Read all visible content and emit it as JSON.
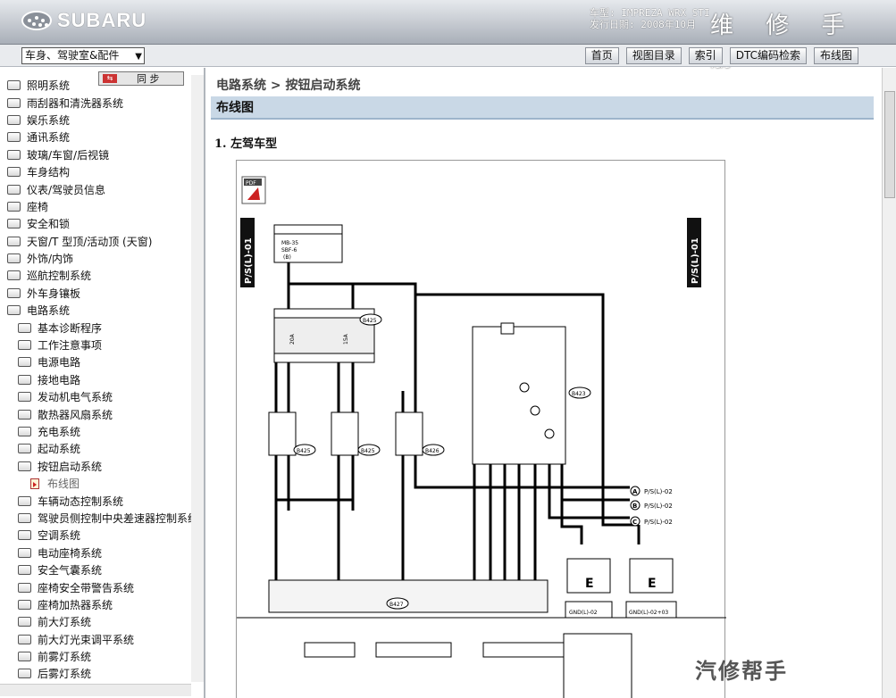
{
  "header": {
    "brand": "SUBARU",
    "model_line": "车型: IMPREZA WRX STI",
    "date_line": "发行日期: 2008年10月",
    "title": "维 修 手 册"
  },
  "toolbar": {
    "category_selected": "车身、驾驶室&配件",
    "buttons": [
      "首页",
      "视图目录",
      "索引",
      "DTC编码检索",
      "布线图"
    ]
  },
  "sidebar": {
    "sync_label": "同 步",
    "items": [
      {
        "label": "照明系统",
        "level": 0
      },
      {
        "label": "雨刮器和清洗器系统",
        "level": 0
      },
      {
        "label": "娱乐系统",
        "level": 0
      },
      {
        "label": "通讯系统",
        "level": 0
      },
      {
        "label": "玻璃/车窗/后视镜",
        "level": 0
      },
      {
        "label": "车身结构",
        "level": 0
      },
      {
        "label": "仪表/驾驶员信息",
        "level": 0
      },
      {
        "label": "座椅",
        "level": 0
      },
      {
        "label": "安全和锁",
        "level": 0
      },
      {
        "label": "天窗/T 型顶/活动顶 (天窗)",
        "level": 0
      },
      {
        "label": "外饰/内饰",
        "level": 0
      },
      {
        "label": "巡航控制系统",
        "level": 0
      },
      {
        "label": "外车身镶板",
        "level": 0
      },
      {
        "label": "电路系统",
        "level": 0
      },
      {
        "label": "基本诊断程序",
        "level": 1
      },
      {
        "label": "工作注意事项",
        "level": 1
      },
      {
        "label": "电源电路",
        "level": 1
      },
      {
        "label": "接地电路",
        "level": 1
      },
      {
        "label": "发动机电气系统",
        "level": 1
      },
      {
        "label": "散热器风扇系统",
        "level": 1
      },
      {
        "label": "充电系统",
        "level": 1
      },
      {
        "label": "起动系统",
        "level": 1
      },
      {
        "label": "按钮启动系统",
        "level": 1
      },
      {
        "label": "布线图",
        "level": 2
      },
      {
        "label": "车辆动态控制系统",
        "level": 1
      },
      {
        "label": "驾驶员侧控制中央差速器控制系统",
        "level": 1
      },
      {
        "label": "空调系统",
        "level": 1
      },
      {
        "label": "电动座椅系统",
        "level": 1
      },
      {
        "label": "安全气囊系统",
        "level": 1
      },
      {
        "label": "座椅安全带警告系统",
        "level": 1
      },
      {
        "label": "座椅加热器系统",
        "level": 1
      },
      {
        "label": "前大灯系统",
        "level": 1
      },
      {
        "label": "前大灯光束调平系统",
        "level": 1
      },
      {
        "label": "前雾灯系统",
        "level": 1
      },
      {
        "label": "后雾灯系统",
        "level": 1
      }
    ]
  },
  "content": {
    "breadcrumb": "电路系统 > 按钮启动系统",
    "section_title": "布线图",
    "subtitle": "1.  左驾车型"
  },
  "diagram": {
    "pdf_label": "PDF",
    "page_code": "P/S(L)-01",
    "box_top": [
      "MB-35",
      "SBF-6",
      "(B)"
    ],
    "connectors": [
      "B425",
      "B426",
      "B427",
      "B420",
      "B423"
    ],
    "arrow_labels": [
      "P/S(L)-02",
      "P/S(L)-02",
      "P/S(L)-02"
    ],
    "arrow_letters": [
      "A",
      "B",
      "C"
    ],
    "ground_labels": [
      "GND(L)-02",
      "GND(L)-02+03"
    ],
    "ground_letter": "E",
    "fuses": [
      "20A",
      "15A"
    ],
    "ecu_label": "B427"
  },
  "watermark": "汽修帮手",
  "colors": {
    "header": "#a9afb8",
    "section_bar": "#c9d8e6",
    "wire": "#000000"
  }
}
